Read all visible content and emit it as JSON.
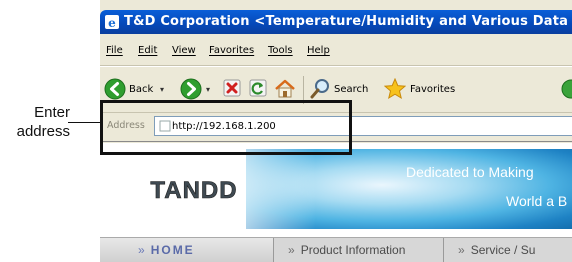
{
  "callout": {
    "line1": "Enter",
    "line2": "address"
  },
  "window": {
    "title": "T&D Corporation <Temperature/Humidity and Various Data Lo"
  },
  "menu": {
    "items": [
      "File",
      "Edit",
      "View",
      "Favorites",
      "Tools",
      "Help"
    ]
  },
  "toolbar": {
    "back_label": "Back",
    "search_label": "Search",
    "favorites_label": "Favorites"
  },
  "address": {
    "label": "Address",
    "value": "http://192.168.1.200"
  },
  "banner": {
    "logo_text": "TANDD",
    "tagline_1": "Dedicated to Making",
    "tagline_2": "World a B"
  },
  "nav": {
    "home": "HOME",
    "product": "Product Information",
    "service": "Service / Su",
    "arrow": "»"
  },
  "colors": {
    "titlebar": "#0548b8",
    "nav_home_text": "#5a6aa8",
    "banner_blue": "#1e82c4"
  }
}
